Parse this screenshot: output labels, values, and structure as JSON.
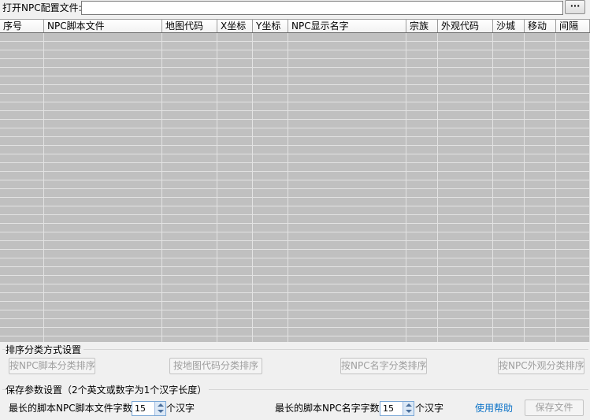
{
  "top": {
    "open_label": "打开NPC配置文件:",
    "file_path": "",
    "browse_label": "···"
  },
  "grid": {
    "columns": [
      "序号",
      "NPC脚本文件",
      "地图代码",
      "X坐标",
      "Y坐标",
      "NPC显示名字",
      "宗族",
      "外观代码",
      "沙城",
      "移动",
      "间隔"
    ],
    "rows": []
  },
  "sort_group": {
    "title": "排序分类方式设置",
    "buttons": [
      "按NPC脚本分类排序",
      "按地图代码分类排序",
      "按NPC名字分类排序",
      "按NPC外观分类排序"
    ]
  },
  "save_group": {
    "title": "保存参数设置（2个英文或数字为1个汉字长度）",
    "script_len_label": "最长的脚本NPC脚本文件字数:",
    "script_len_value": "15",
    "script_len_unit": "个汉字",
    "name_len_label": "最长的脚本NPC名字字数:",
    "name_len_value": "15",
    "name_len_unit": "个汉字",
    "help_label": "使用帮助",
    "save_label": "保存文件"
  }
}
